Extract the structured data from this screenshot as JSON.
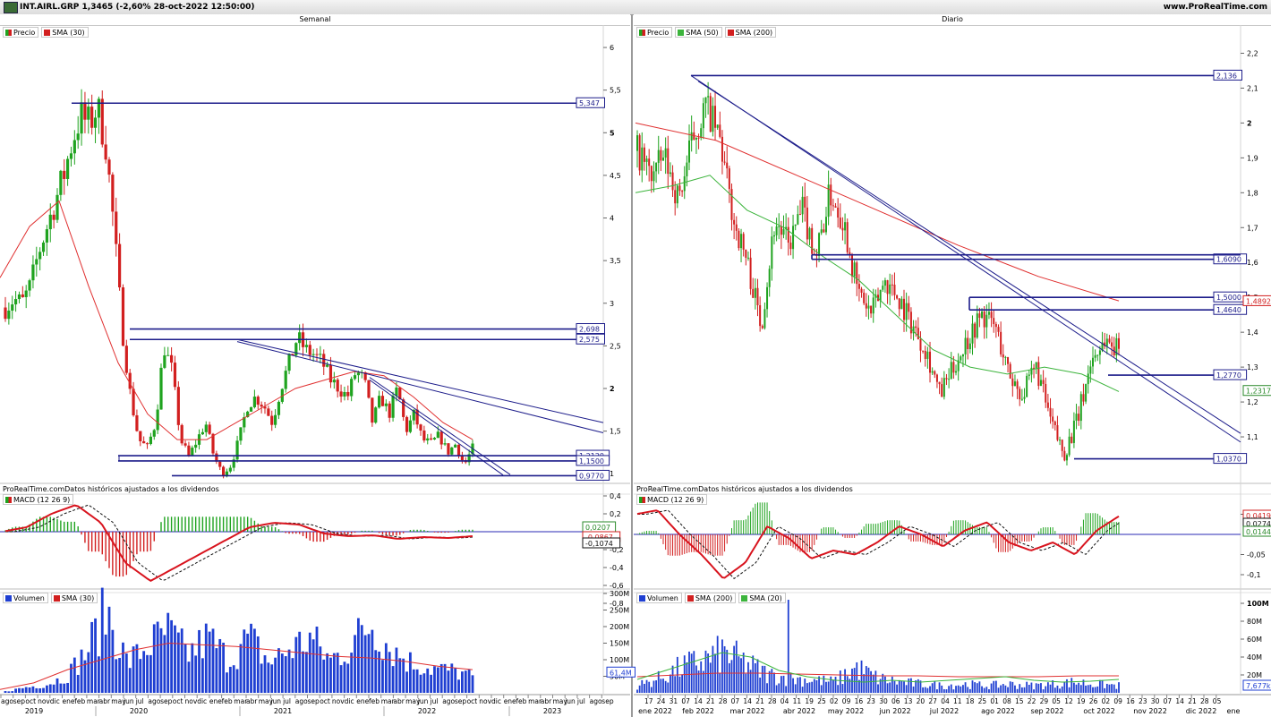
{
  "header": {
    "instrument": "INT.AIRL.GRP 1,3465 (-2,60% 28-oct-2022 12:50:00)",
    "site": "www.ProRealTime.com"
  },
  "note": "ProRealTime.comDatos históricos ajustados a los dividendos",
  "colors": {
    "up": "#1fa31f",
    "down": "#d21f1f",
    "level": "#1c1c8a",
    "sma_red": "#e03030",
    "sma_green": "#3cb43c",
    "volume": "#1f3fd2",
    "macd": "#d8141e"
  },
  "weekly": {
    "title": "Semanal",
    "legend_price": [
      "Precio",
      "SMA (30)"
    ],
    "legend_macd": "MACD (12 26 9)",
    "legend_vol": [
      "Volumen",
      "SMA (30)"
    ],
    "price_ticks": [
      "6",
      "5,5",
      "5",
      "4,5",
      "4",
      "3,5",
      "3",
      "2,5",
      "2",
      "1,5",
      "1"
    ],
    "levels": [
      "5,347",
      "2,698",
      "2,575",
      "1,2120",
      "1,1500",
      "0,9770"
    ],
    "macd_ticks": [
      "0,4",
      "0,2",
      "-0,2",
      "-0,4",
      "-0,6",
      "-0,8"
    ],
    "macd_boxes": [
      "0,0207",
      "-0,0867",
      "-0,1074"
    ],
    "vol_ticks": [
      "300M",
      "250M",
      "200M",
      "150M",
      "100M",
      "50M"
    ],
    "vol_box": "61,4M",
    "months": [
      "ago",
      "sep",
      "oct",
      "nov",
      "dic",
      "ene",
      "feb",
      "mar",
      "abr",
      "may",
      "jun",
      "jul",
      "ago",
      "sep",
      "oct",
      "nov",
      "dic",
      "ene",
      "feb",
      "mar",
      "abr",
      "may",
      "jun",
      "jul",
      "ago",
      "sep",
      "oct",
      "nov",
      "dic",
      "ene",
      "feb",
      "mar",
      "abr",
      "may",
      "jun",
      "jul",
      "ago",
      "sep",
      "oct",
      "nov",
      "dic",
      "ene",
      "feb",
      "mar",
      "abr",
      "may",
      "jun",
      "jul",
      "ago",
      "sep"
    ],
    "years": [
      "2019",
      "2020",
      "2021",
      "2022",
      "2023"
    ]
  },
  "daily": {
    "title": "Diario",
    "legend_price": [
      "Precio",
      "SMA (50)",
      "SMA (200)"
    ],
    "legend_macd": "MACD (12 26 9)",
    "legend_vol": [
      "Volumen",
      "SMA (200)",
      "SMA (20)"
    ],
    "price_ticks": [
      "2,2",
      "2,1",
      "2",
      "1,9",
      "1,8",
      "1,7",
      "1,6",
      "1,5",
      "1,4",
      "1,3",
      "1,2",
      "1,1"
    ],
    "levels": [
      "2,136",
      "1,6090",
      "1,5000",
      "1,4640",
      "1,2770",
      "1,0370"
    ],
    "sma_boxes": [
      "1,4892",
      "1,2317"
    ],
    "macd_ticks": [
      "0,05",
      "-0,05",
      "-0,1"
    ],
    "macd_boxes": [
      "0,0419",
      "0,0274",
      "0,0144"
    ],
    "vol_ticks": [
      "100M",
      "80M",
      "60M",
      "40M",
      "20M"
    ],
    "vol_box": "7,677k",
    "days": [
      "17",
      "24",
      "31",
      "07",
      "14",
      "21",
      "28",
      "07",
      "14",
      "21",
      "28",
      "04",
      "11",
      "19",
      "25",
      "02",
      "09",
      "16",
      "23",
      "30",
      "06",
      "13",
      "20",
      "27",
      "04",
      "11",
      "18",
      "25",
      "01",
      "08",
      "15",
      "22",
      "29",
      "05",
      "12",
      "19",
      "26",
      "02",
      "09",
      "16",
      "23",
      "30",
      "07",
      "14",
      "21",
      "28",
      "05"
    ],
    "months": [
      "ene 2022",
      "feb 2022",
      "mar 2022",
      "abr 2022",
      "may 2022",
      "jun 2022",
      "jul 2022",
      "ago 2022",
      "sep 2022",
      "oct 2022",
      "nov 2022",
      "dic 2022",
      "ene"
    ]
  },
  "chart_data": [
    {
      "type": "candlestick",
      "title": "Semanal",
      "series": [
        {
          "name": "Precio",
          "values": [
            2.95,
            3.05,
            3.0,
            3.2,
            3.6,
            3.9,
            4.2,
            4.5,
            4.9,
            5.2,
            5.1,
            5.3,
            4.9,
            3.9,
            2.7,
            1.9,
            1.4,
            1.3,
            1.6,
            2.5,
            2.2,
            1.4,
            1.2,
            1.4,
            1.6,
            1.2,
            1.0,
            1.1,
            1.4,
            1.8,
            1.9,
            1.8,
            1.6,
            2.0,
            2.3,
            2.6,
            2.45,
            2.4,
            2.3,
            2.1,
            2.0,
            1.9,
            2.2,
            2.1,
            1.6,
            1.9,
            1.7,
            2.0,
            1.5,
            1.7,
            1.4,
            1.35,
            1.45,
            1.25,
            1.35,
            1.1,
            1.3
          ]
        },
        {
          "name": "SMA (30)",
          "values": [
            3.3,
            3.9,
            4.2,
            3.2,
            2.3,
            1.7,
            1.4,
            1.4,
            1.6,
            1.8,
            2.0,
            2.1,
            2.2,
            2.15,
            1.9,
            1.6,
            1.4
          ]
        }
      ],
      "levels": [
        5.347,
        2.698,
        2.575,
        1.212,
        1.15,
        0.977
      ],
      "ylim": [
        0.95,
        6.2
      ]
    },
    {
      "type": "candlestick",
      "title": "Diario",
      "series": [
        {
          "name": "Precio",
          "values": [
            1.92,
            1.85,
            1.9,
            1.78,
            1.95,
            2.05,
            1.95,
            1.72,
            1.6,
            1.42,
            1.72,
            1.65,
            1.75,
            1.62,
            1.8,
            1.72,
            1.52,
            1.45,
            1.55,
            1.5,
            1.42,
            1.35,
            1.22,
            1.3,
            1.38,
            1.45,
            1.42,
            1.28,
            1.22,
            1.3,
            1.15,
            1.05,
            1.15,
            1.32,
            1.38,
            1.35
          ]
        },
        {
          "name": "SMA (50)",
          "values": [
            1.8,
            1.82,
            1.85,
            1.75,
            1.7,
            1.62,
            1.55,
            1.45,
            1.35,
            1.3,
            1.28,
            1.3,
            1.28,
            1.23
          ]
        },
        {
          "name": "SMA (200)",
          "values": [
            2.0,
            1.95,
            1.85,
            1.75,
            1.65,
            1.56,
            1.49
          ]
        }
      ],
      "levels": [
        2.136,
        1.609,
        1.5,
        1.464,
        1.277,
        1.037
      ],
      "ylim": [
        1.0,
        2.25
      ]
    }
  ]
}
